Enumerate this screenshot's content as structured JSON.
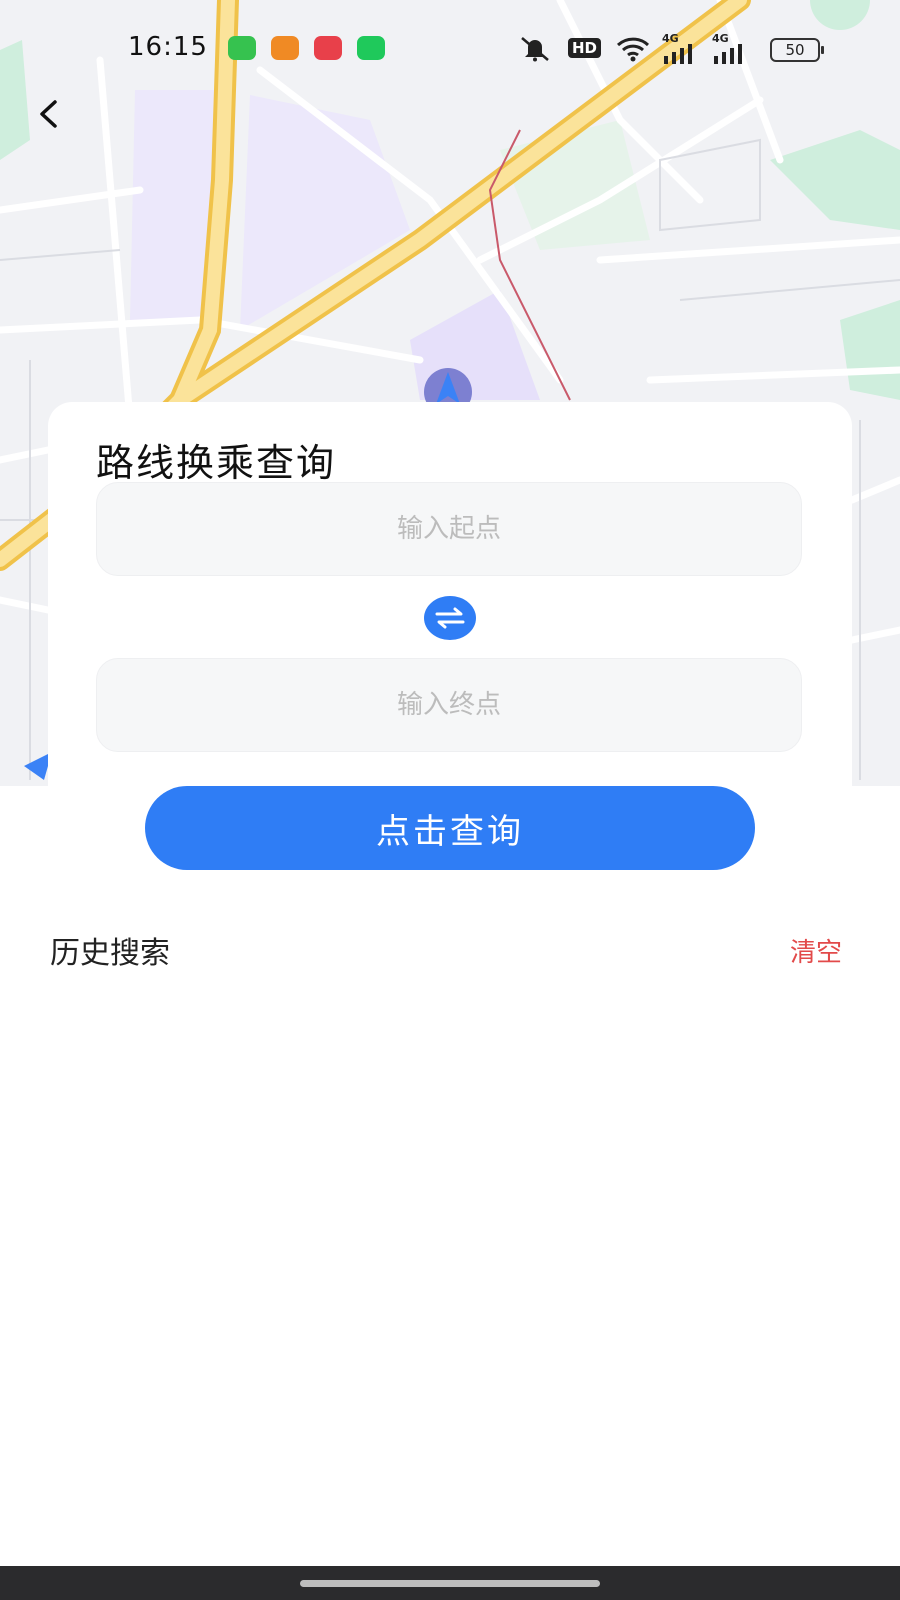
{
  "status_bar": {
    "time": "16:15",
    "app_icons": [
      {
        "name": "message-app-icon",
        "color": "#36c24f"
      },
      {
        "name": "orange-app-icon",
        "color": "#f08a24"
      },
      {
        "name": "video-app-icon",
        "color": "#e8404a"
      },
      {
        "name": "green-app-icon",
        "color": "#1fc95b"
      }
    ],
    "hd_label": "HD",
    "network_label_1": "4G",
    "network_label_2": "4G",
    "battery_level": "50"
  },
  "route_card": {
    "title": "路线换乘查询",
    "start_placeholder": "输入起点",
    "end_placeholder": "输入终点"
  },
  "query_button_label": "点击查询",
  "history": {
    "title": "历史搜索",
    "clear_label": "清空"
  },
  "colors": {
    "accent": "#2f7df5",
    "clear_red": "#e24a4a",
    "map_road_yellow": "#f6d36b",
    "map_block_purple": "#ece8fb"
  }
}
